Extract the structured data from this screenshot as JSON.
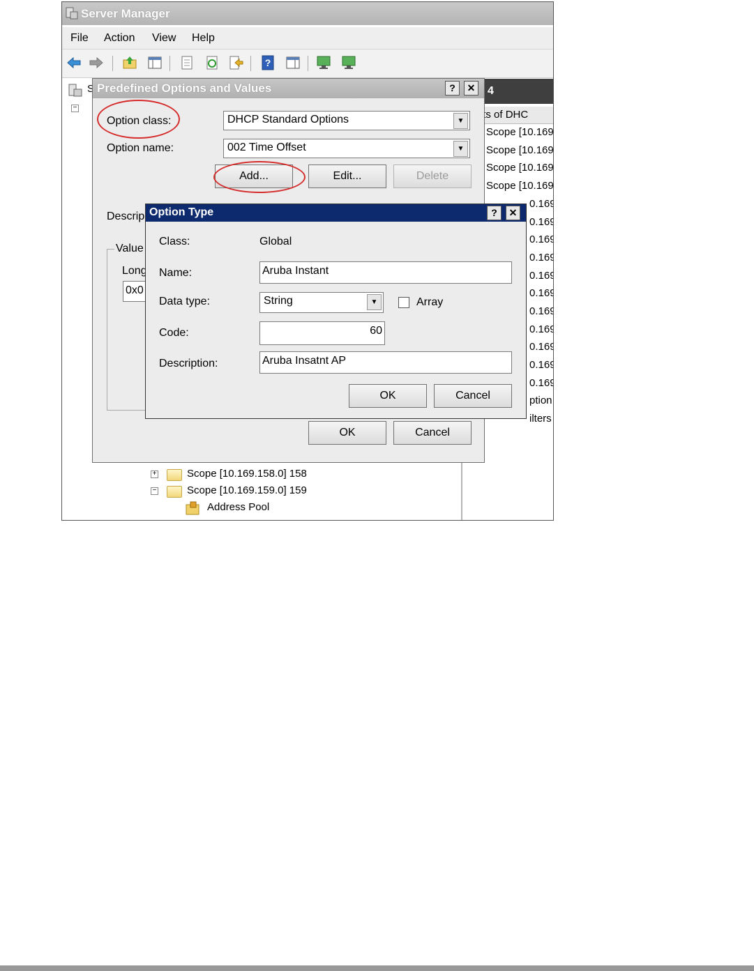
{
  "server_manager": {
    "title": "Server Manager",
    "menu": [
      "File",
      "Action",
      "View",
      "Help"
    ],
    "toolbar_icons": [
      "back-icon",
      "forward-icon",
      "up-folder-icon",
      "show-hide-tree-icon",
      "properties-icon",
      "refresh-icon",
      "export-icon",
      "help-icon",
      "action-pane-icon",
      "computer-icon",
      "computer-network-icon"
    ],
    "tree": {
      "partial_root": "S",
      "items": [
        {
          "label": "Scope [10.169.158.0] 158",
          "expander": "+"
        },
        {
          "label": "Scope [10.169.159.0] 159",
          "expander": "−"
        },
        {
          "label": "Address Pool"
        }
      ]
    },
    "right_pane": {
      "header": "4",
      "column": "ntents of DHC",
      "rows": [
        "Scope [10.169",
        "Scope [10.169",
        "Scope [10.169",
        "Scope [10.169",
        "0.169",
        "0.169",
        "0.169",
        "0.169",
        "0.169",
        "0.169",
        "0.169",
        "0.169",
        "0.169",
        "0.169",
        "0.169",
        "ption",
        "ilters"
      ]
    }
  },
  "predefined_dialog": {
    "title": "Predefined Options and Values",
    "help_button": "?",
    "close_button": "✕",
    "option_class_label": "Option class:",
    "option_class_value": "DHCP Standard Options",
    "option_name_label": "Option name:",
    "option_name_value": "002 Time Offset",
    "add_label": "Add...",
    "edit_label": "Edit...",
    "delete_label": "Delete",
    "description_label": "Descrip",
    "value_group_label": "Value",
    "long_label": "Long",
    "value_field": "0x0",
    "ok_label": "OK",
    "cancel_label": "Cancel"
  },
  "option_type_dialog": {
    "title": "Option Type",
    "help_button": "?",
    "close_button": "✕",
    "class_label": "Class:",
    "class_value": "Global",
    "name_label": "Name:",
    "name_value": "Aruba Instant",
    "data_type_label": "Data type:",
    "data_type_value": "String",
    "array_label": "Array",
    "array_checked": false,
    "code_label": "Code:",
    "code_value": "60",
    "description_label": "Description:",
    "description_value": "Aruba Insatnt AP",
    "ok_label": "OK",
    "cancel_label": "Cancel"
  },
  "colors": {
    "highlight_circle": "#d62b2b",
    "option_type_titlebar": "#0c2a6d"
  }
}
